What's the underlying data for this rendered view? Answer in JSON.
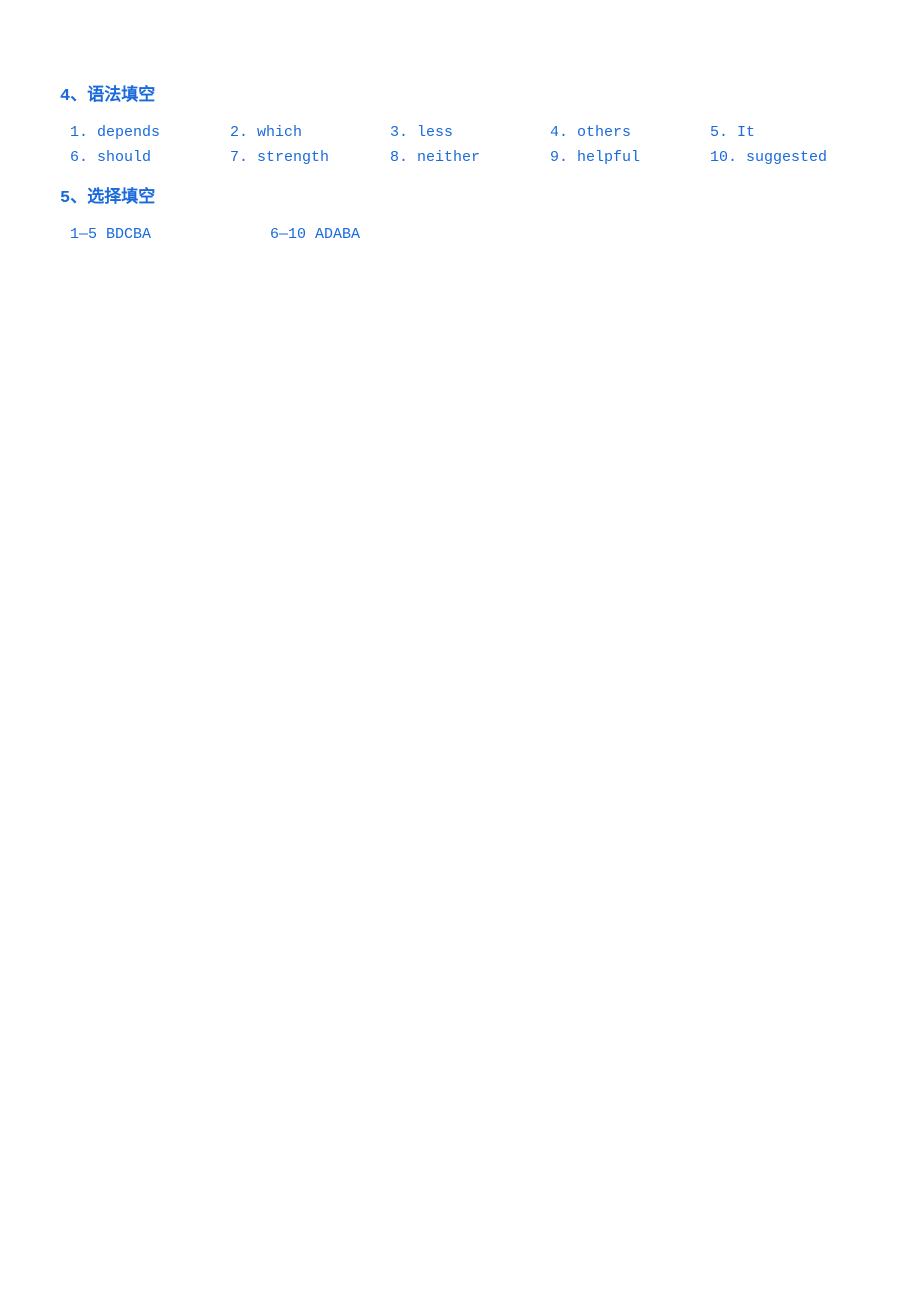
{
  "section4": {
    "title": "4、语法填空",
    "answers": [
      {
        "num": "1.",
        "word": "depends"
      },
      {
        "num": "2.",
        "word": "which"
      },
      {
        "num": "3.",
        "word": "less"
      },
      {
        "num": "4.",
        "word": "others"
      },
      {
        "num": "5.",
        "word": "It"
      },
      {
        "num": "6.",
        "word": "should"
      },
      {
        "num": "7.",
        "word": "strength"
      },
      {
        "num": "8.",
        "word": "neither"
      },
      {
        "num": "9.",
        "word": "helpful"
      },
      {
        "num": "10.",
        "word": "suggested"
      }
    ]
  },
  "section5": {
    "title": "5、选择填空",
    "answers": [
      {
        "range": "1—5",
        "value": "BDCBA"
      },
      {
        "range": "6—10",
        "value": "ADABA"
      }
    ]
  }
}
